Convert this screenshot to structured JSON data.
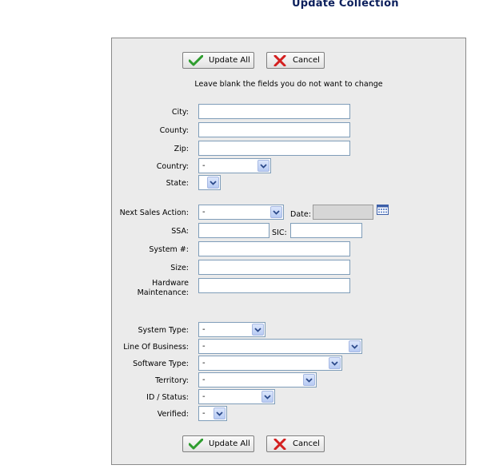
{
  "page": {
    "title": "Update Collection"
  },
  "buttons": {
    "update_all": "Update All",
    "cancel": "Cancel"
  },
  "instruction": "Leave blank the fields you do not want to change",
  "fields": {
    "city": {
      "label": "City:",
      "value": ""
    },
    "county": {
      "label": "County:",
      "value": ""
    },
    "zip": {
      "label": "Zip:",
      "value": ""
    },
    "country": {
      "label": "Country:",
      "value": "-"
    },
    "state": {
      "label": "State:",
      "value": ""
    },
    "next_sales_action": {
      "label": "Next Sales Action:",
      "value": "-"
    },
    "date": {
      "label": "Date:",
      "value": ""
    },
    "ssa": {
      "label": "SSA:",
      "value": ""
    },
    "sic": {
      "label": "SIC:",
      "value": ""
    },
    "system_num": {
      "label": "System #:",
      "value": ""
    },
    "size": {
      "label": "Size:",
      "value": ""
    },
    "hardware_maintenance": {
      "label_line1": "Hardware",
      "label_line2": "Maintenance:",
      "value": ""
    },
    "system_type": {
      "label": "System Type:",
      "value": "-"
    },
    "line_of_business": {
      "label": "Line Of Business:",
      "value": "-"
    },
    "software_type": {
      "label": "Software Type:",
      "value": "-"
    },
    "territory": {
      "label": "Territory:",
      "value": "-"
    },
    "id_status": {
      "label": "ID / Status:",
      "value": "-"
    },
    "verified": {
      "label": "Verified:",
      "value": "-"
    }
  },
  "icons": {
    "update": "green-check-icon",
    "cancel": "red-x-icon",
    "calendar": "calendar-icon",
    "dropdown": "chevron-down-icon"
  },
  "colors": {
    "title": "#0b1f5c",
    "panel_bg": "#ebebeb",
    "input_border": "#7f9db9",
    "dropdown_button": "#b7caf3"
  }
}
